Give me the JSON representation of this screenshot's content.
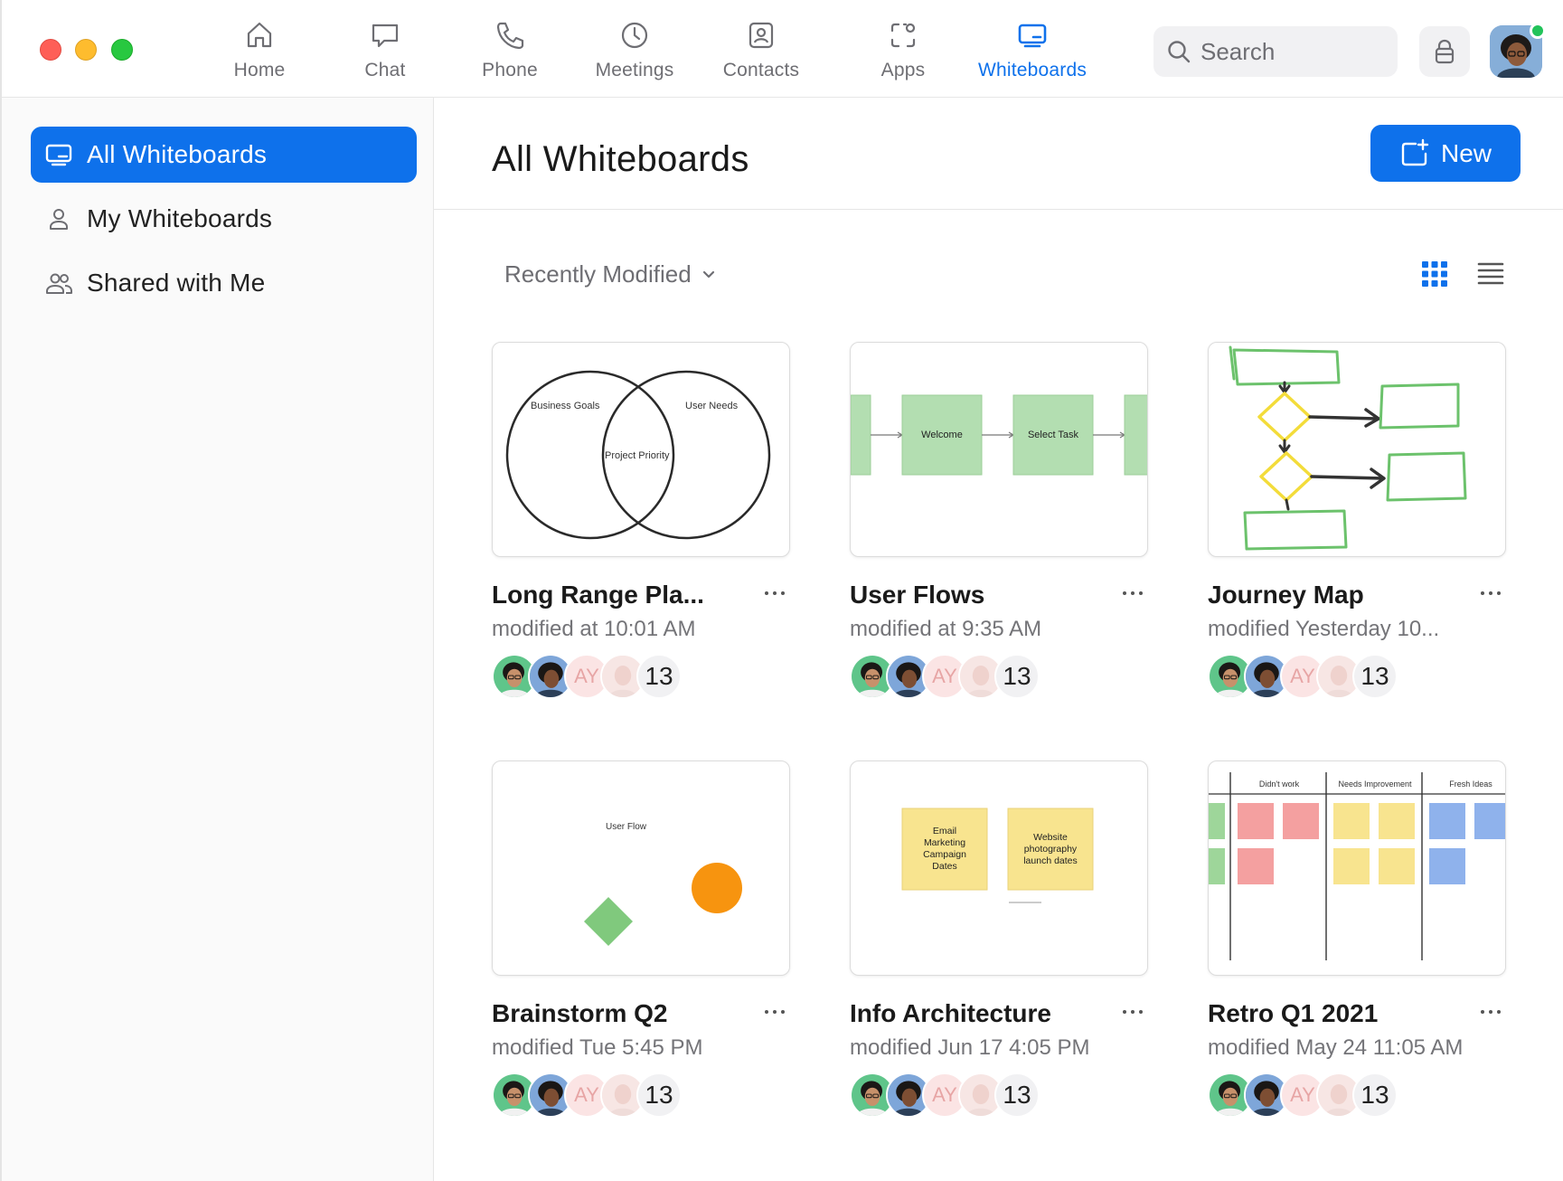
{
  "nav": {
    "items": [
      {
        "label": "Home",
        "icon": "home-icon"
      },
      {
        "label": "Chat",
        "icon": "chat-icon"
      },
      {
        "label": "Phone",
        "icon": "phone-icon"
      },
      {
        "label": "Meetings",
        "icon": "clock-icon"
      },
      {
        "label": "Contacts",
        "icon": "contacts-icon"
      },
      {
        "label": "Apps",
        "icon": "apps-icon"
      },
      {
        "label": "Whiteboards",
        "icon": "whiteboard-icon",
        "active": true
      }
    ]
  },
  "search": {
    "placeholder": "Search"
  },
  "colors": {
    "accent": "#0e71eb",
    "online": "#22c35a"
  },
  "sidebar": {
    "items": [
      {
        "label": "All Whiteboards",
        "active": true
      },
      {
        "label": "My Whiteboards"
      },
      {
        "label": "Shared with Me"
      }
    ]
  },
  "main": {
    "title": "All Whiteboards",
    "new_label": "New",
    "sort_label": "Recently Modified",
    "view": "grid"
  },
  "cards": [
    {
      "title": "Long Range Pla...",
      "modified": "modified at 10:01 AM",
      "count": "13",
      "initials": "AY",
      "thumb": {
        "labels": [
          "Business Goals",
          "User Needs",
          "Project Priority"
        ]
      }
    },
    {
      "title": "User Flows",
      "modified": "modified at 9:35 AM",
      "count": "13",
      "initials": "AY",
      "thumb": {
        "labels": [
          "Welcome",
          "Select Task"
        ]
      }
    },
    {
      "title": "Journey Map",
      "modified": "modified Yesterday 10...",
      "count": "13",
      "initials": "AY"
    },
    {
      "title": "Brainstorm Q2",
      "modified": "modified Tue 5:45 PM",
      "count": "13",
      "initials": "AY",
      "thumb": {
        "labels": [
          "User Flow"
        ]
      }
    },
    {
      "title": "Info Architecture",
      "modified": "modified Jun 17 4:05 PM",
      "count": "13",
      "initials": "AY",
      "thumb": {
        "labels": [
          "Email Marketing Campaign Dates",
          "Website photography launch dates"
        ]
      }
    },
    {
      "title": "Retro Q1 2021",
      "modified": "modified May 24 11:05 AM",
      "count": "13",
      "initials": "AY",
      "thumb": {
        "labels": [
          "Didn't work",
          "Needs Improvement",
          "Fresh Ideas"
        ]
      }
    }
  ]
}
